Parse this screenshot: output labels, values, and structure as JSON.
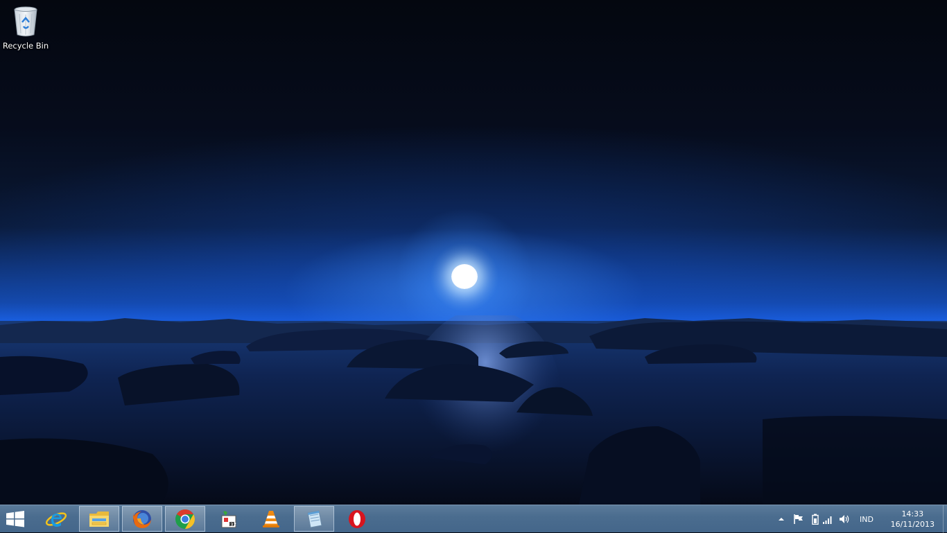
{
  "desktop": {
    "wallpaper": "night-sea-moon",
    "icons": [
      {
        "label": "Recycle Bin",
        "icon": "recycle-bin-icon"
      }
    ]
  },
  "taskbar": {
    "start": {
      "icon": "windows-start-icon"
    },
    "pinned": [
      {
        "name": "Internet Explorer",
        "icon": "internet-explorer-icon",
        "active": false
      },
      {
        "name": "File Explorer",
        "icon": "file-explorer-icon",
        "active": true
      },
      {
        "name": "Firefox",
        "icon": "firefox-icon",
        "active": true
      },
      {
        "name": "Google Chrome",
        "icon": "chrome-icon",
        "active": true
      },
      {
        "name": "Taskbar app",
        "icon": "app-icon",
        "active": false
      },
      {
        "name": "VLC media player",
        "icon": "vlc-icon",
        "active": false
      },
      {
        "name": "Notepad",
        "icon": "notepad-icon",
        "active": true
      },
      {
        "name": "Opera",
        "icon": "opera-icon",
        "active": false
      }
    ],
    "tray": {
      "icons": [
        "show-hidden-icons-icon",
        "action-center-flag-icon",
        "battery-icon",
        "network-signal-icon",
        "volume-icon"
      ],
      "language": "IND",
      "time": "14:33",
      "date": "16/11/2013"
    }
  },
  "colors": {
    "taskbar": "#4b6d8f",
    "sky_glow": "#1a5fe0",
    "moon": "#ffffff"
  }
}
